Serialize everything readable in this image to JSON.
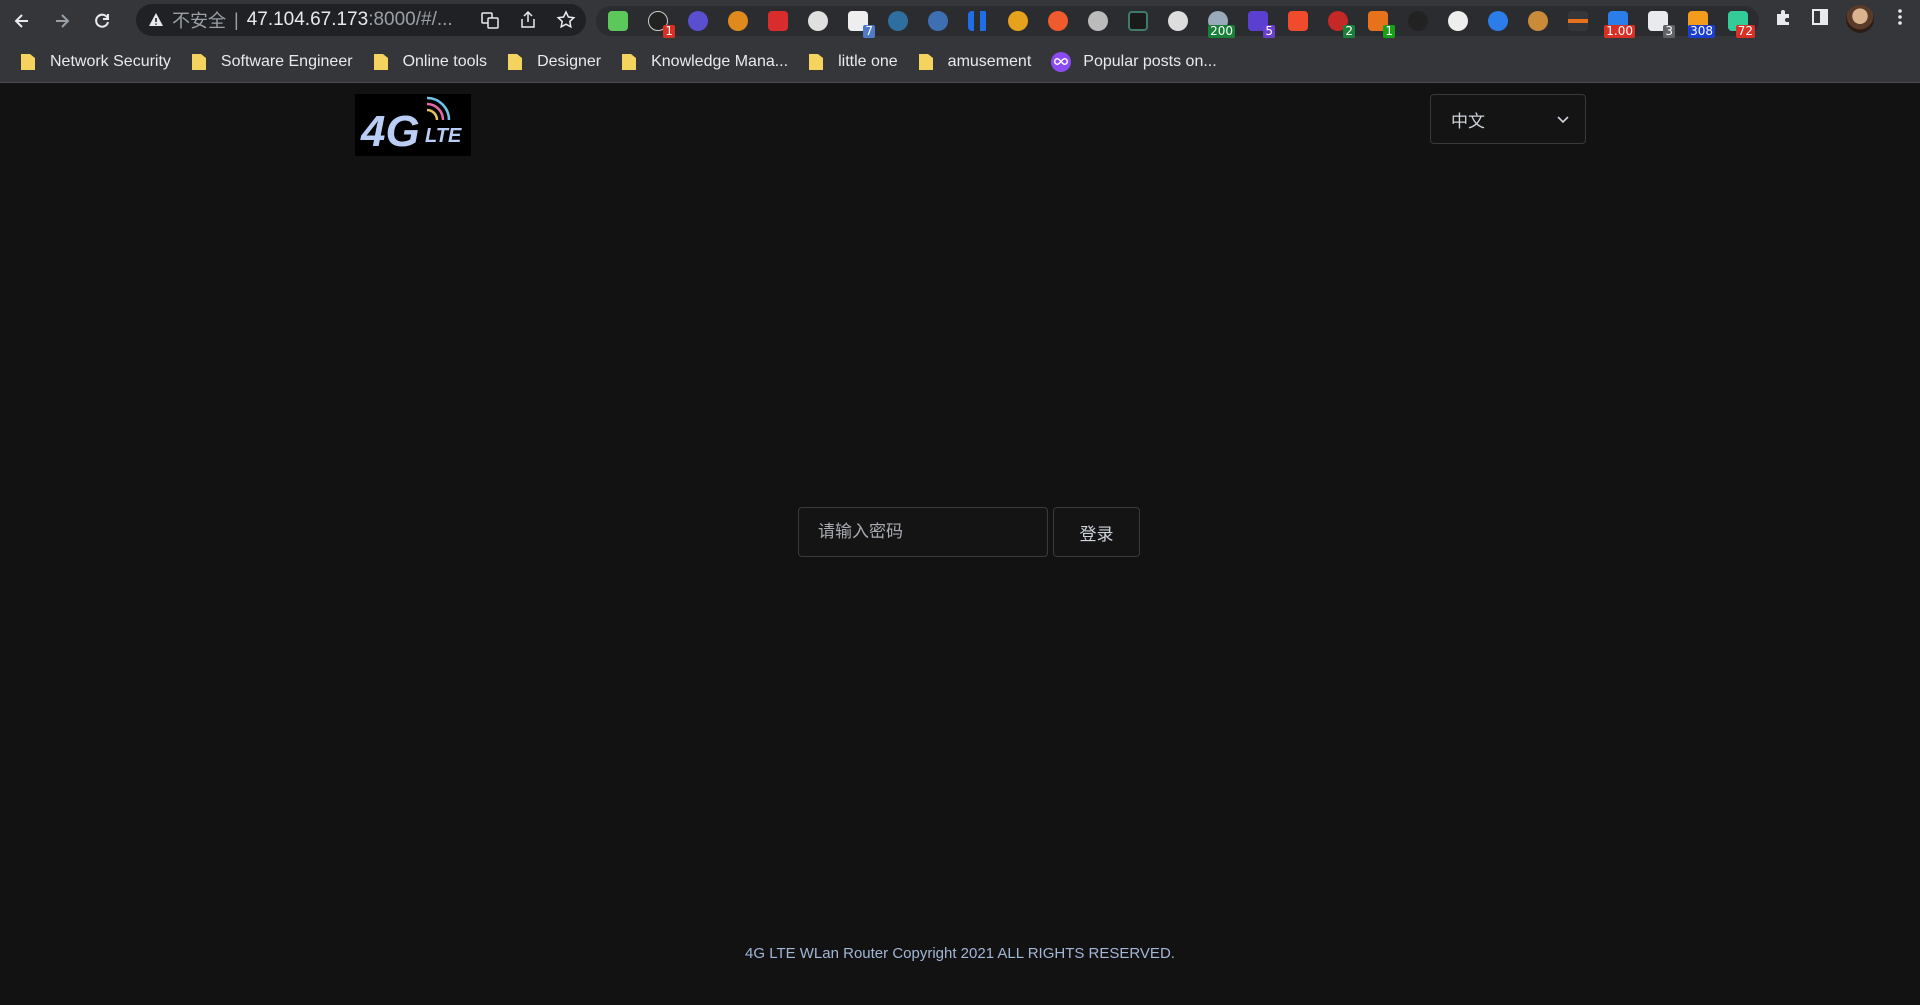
{
  "browser": {
    "address_insecure": "不安全",
    "address_host": "47.104.67.173",
    "address_path": ":8000/#/...",
    "extension_badges": [
      "1",
      "7",
      "200",
      "5",
      "2",
      "1",
      "1.00",
      "3",
      "308",
      "72"
    ]
  },
  "bookmarks": [
    {
      "label": "Network Security",
      "icon": "folder-icon"
    },
    {
      "label": "Software Engineer",
      "icon": "folder-icon"
    },
    {
      "label": "Online tools",
      "icon": "folder-icon"
    },
    {
      "label": "Designer",
      "icon": "folder-icon"
    },
    {
      "label": "Knowledge Mana...",
      "icon": "folder-icon"
    },
    {
      "label": "little one",
      "icon": "folder-icon"
    },
    {
      "label": "amusement",
      "icon": "folder-icon"
    },
    {
      "label": "Popular posts on...",
      "icon": "infinity-icon"
    }
  ],
  "page": {
    "language_selected": "中文",
    "password_placeholder": "请输入密码",
    "login_label": "登录",
    "footer": "4G LTE WLan Router Copyright 2021 ALL RIGHTS RESERVED.",
    "colors": {
      "background": "#121212",
      "border": "#3a3a3a",
      "footer_text": "#a3b6d6"
    }
  }
}
